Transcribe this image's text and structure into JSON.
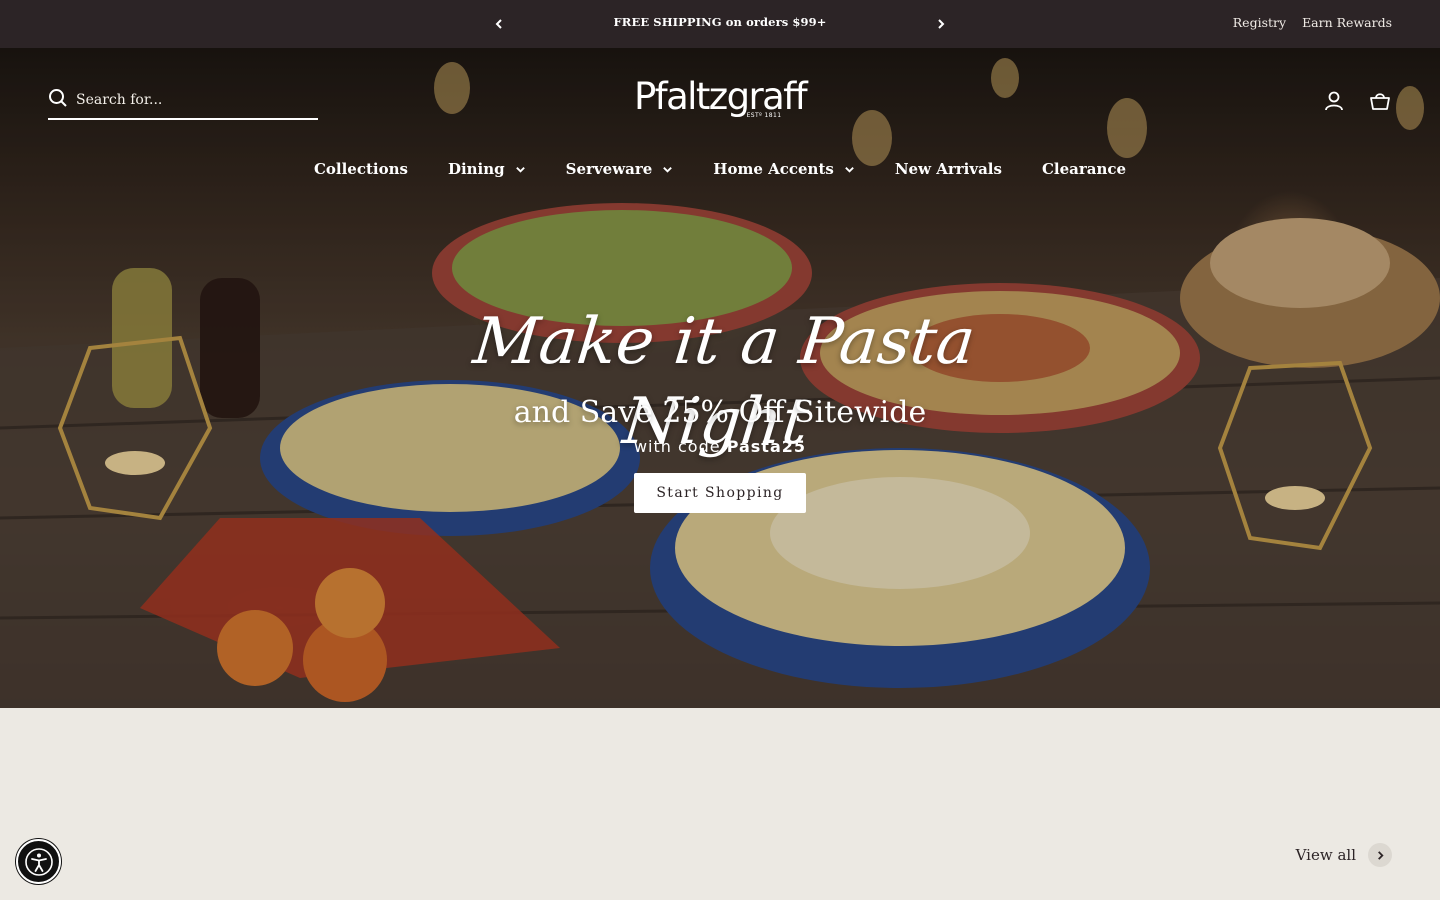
{
  "announcement": {
    "message": "FREE SHIPPING on orders $99+",
    "prev_icon": "chevron-left-icon",
    "next_icon": "chevron-right-icon",
    "links": [
      "Registry",
      "Earn Rewards"
    ]
  },
  "header": {
    "search_placeholder": "Search for...",
    "logo_text": "Pfaltzgraff",
    "logo_est": "ESTº 1811",
    "icons": [
      "account-icon",
      "cart-icon"
    ]
  },
  "nav": {
    "items": [
      {
        "label": "Collections",
        "has_dropdown": false
      },
      {
        "label": "Dining",
        "has_dropdown": true
      },
      {
        "label": "Serveware",
        "has_dropdown": true
      },
      {
        "label": "Home Accents",
        "has_dropdown": true
      },
      {
        "label": "New Arrivals",
        "has_dropdown": false
      },
      {
        "label": "Clearance",
        "has_dropdown": false
      }
    ]
  },
  "hero": {
    "script_title": "Make it a Pasta Night",
    "subtitle": "and Save 25% Off Sitewide",
    "code_prefix": "with code",
    "code": "Pasta25",
    "cta_label": "Start Shopping"
  },
  "section": {
    "view_all_label": "View all"
  },
  "colors": {
    "top_bar": "#2c2426",
    "page_bg": "#ece9e3",
    "text_dark": "#2c2426"
  }
}
